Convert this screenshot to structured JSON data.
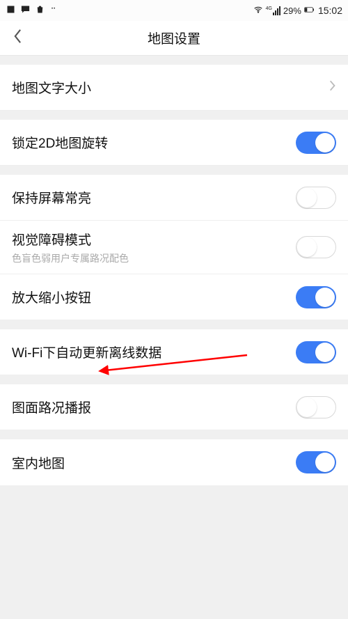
{
  "status_bar": {
    "battery_percent": "29%",
    "time": "15:02",
    "network_label": "4G"
  },
  "header": {
    "title": "地图设置"
  },
  "groups": [
    {
      "items": [
        {
          "key": "text_size",
          "label": "地图文字大小",
          "type": "chevron"
        }
      ]
    },
    {
      "items": [
        {
          "key": "lock_2d_rotate",
          "label": "锁定2D地图旋转",
          "type": "toggle",
          "state": "on"
        }
      ]
    },
    {
      "items": [
        {
          "key": "keep_awake",
          "label": "保持屏幕常亮",
          "type": "toggle",
          "state": "off"
        },
        {
          "key": "vis_impaired",
          "label": "视觉障碍模式",
          "sub": "色盲色弱用户专属路况配色",
          "type": "toggle",
          "state": "off"
        },
        {
          "key": "zoom_buttons",
          "label": "放大缩小按钮",
          "type": "toggle",
          "state": "on"
        }
      ]
    },
    {
      "items": [
        {
          "key": "wifi_offline",
          "label": "Wi-Fi下自动更新离线数据",
          "type": "toggle",
          "state": "on"
        }
      ]
    },
    {
      "items": [
        {
          "key": "traffic_voice",
          "label": "图面路况播报",
          "type": "toggle",
          "state": "off"
        }
      ]
    },
    {
      "items": [
        {
          "key": "indoor_map",
          "label": "室内地图",
          "type": "toggle",
          "state": "on"
        }
      ]
    }
  ]
}
